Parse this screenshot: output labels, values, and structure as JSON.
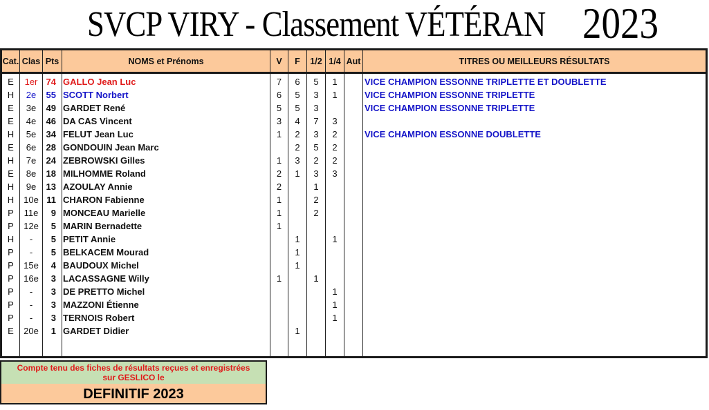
{
  "title": {
    "main": "SVCP VIRY - Classement VÉTÉRAN",
    "year": "2023"
  },
  "table": {
    "headers": [
      "Cat.",
      "Clas",
      "Pts",
      "NOMS et Prénoms",
      "V",
      "F",
      "1/2",
      "1/4",
      "Aut",
      "TITRES OU MEILLEURS RÉSULTATS"
    ],
    "rows": [
      {
        "cat": "E",
        "clas": "1er",
        "pts": "74",
        "name": "GALLO Jean Luc",
        "v": "7",
        "f": "6",
        "half": "5",
        "quarter": "1",
        "aut": "",
        "titre": "VICE CHAMPION ESSONNE TRIPLETTE ET DOUBLETTE",
        "color": "red"
      },
      {
        "cat": "H",
        "clas": "2e",
        "pts": "55",
        "name": "SCOTT Norbert",
        "v": "6",
        "f": "5",
        "half": "3",
        "quarter": "1",
        "aut": "",
        "titre": "VICE CHAMPION ESSONNE TRIPLETTE",
        "color": "blue"
      },
      {
        "cat": "E",
        "clas": "3e",
        "pts": "49",
        "name": "GARDET René",
        "v": "5",
        "f": "5",
        "half": "3",
        "quarter": "",
        "aut": "",
        "titre": "VICE CHAMPION ESSONNE TRIPLETTE",
        "color": ""
      },
      {
        "cat": "E",
        "clas": "4e",
        "pts": "46",
        "name": "DA CAS Vincent",
        "v": "3",
        "f": "4",
        "half": "7",
        "quarter": "3",
        "aut": "",
        "titre": "",
        "color": ""
      },
      {
        "cat": "H",
        "clas": "5e",
        "pts": "34",
        "name": "FELUT Jean Luc",
        "v": "1",
        "f": "2",
        "half": "3",
        "quarter": "2",
        "aut": "",
        "titre": "VICE CHAMPION ESSONNE DOUBLETTE",
        "color": ""
      },
      {
        "cat": "E",
        "clas": "6e",
        "pts": "28",
        "name": "GONDOUIN Jean Marc",
        "v": "",
        "f": "2",
        "half": "5",
        "quarter": "2",
        "aut": "",
        "titre": "",
        "color": ""
      },
      {
        "cat": "H",
        "clas": "7e",
        "pts": "24",
        "name": "ZEBROWSKI Gilles",
        "v": "1",
        "f": "3",
        "half": "2",
        "quarter": "2",
        "aut": "",
        "titre": "",
        "color": ""
      },
      {
        "cat": "E",
        "clas": "8e",
        "pts": "18",
        "name": "MILHOMME Roland",
        "v": "2",
        "f": "1",
        "half": "3",
        "quarter": "3",
        "aut": "",
        "titre": "",
        "color": ""
      },
      {
        "cat": "H",
        "clas": "9e",
        "pts": "13",
        "name": "AZOULAY Annie",
        "v": "2",
        "f": "",
        "half": "1",
        "quarter": "",
        "aut": "",
        "titre": "",
        "color": ""
      },
      {
        "cat": "H",
        "clas": "10e",
        "pts": "11",
        "name": "CHARON Fabienne",
        "v": "1",
        "f": "",
        "half": "2",
        "quarter": "",
        "aut": "",
        "titre": "",
        "color": ""
      },
      {
        "cat": "P",
        "clas": "11e",
        "pts": "9",
        "name": "MONCEAU Marielle",
        "v": "1",
        "f": "",
        "half": "2",
        "quarter": "",
        "aut": "",
        "titre": "",
        "color": ""
      },
      {
        "cat": "P",
        "clas": "12e",
        "pts": "5",
        "name": "MARIN Bernadette",
        "v": "1",
        "f": "",
        "half": "",
        "quarter": "",
        "aut": "",
        "titre": "",
        "color": ""
      },
      {
        "cat": "H",
        "clas": "-",
        "pts": "5",
        "name": "PETIT Annie",
        "v": "",
        "f": "1",
        "half": "",
        "quarter": "1",
        "aut": "",
        "titre": "",
        "color": ""
      },
      {
        "cat": "P",
        "clas": "-",
        "pts": "5",
        "name": "BELKACEM Mourad",
        "v": "",
        "f": "1",
        "half": "",
        "quarter": "",
        "aut": "",
        "titre": "",
        "color": ""
      },
      {
        "cat": "P",
        "clas": "15e",
        "pts": "4",
        "name": "BAUDOUX Michel",
        "v": "",
        "f": "1",
        "half": "",
        "quarter": "",
        "aut": "",
        "titre": "",
        "color": ""
      },
      {
        "cat": "P",
        "clas": "16e",
        "pts": "3",
        "name": "LACASSAGNE Willy",
        "v": "1",
        "f": "",
        "half": "1",
        "quarter": "",
        "aut": "",
        "titre": "",
        "color": ""
      },
      {
        "cat": "P",
        "clas": "-",
        "pts": "3",
        "name": "DE PRETTO Michel",
        "v": "",
        "f": "",
        "half": "",
        "quarter": "1",
        "aut": "",
        "titre": "",
        "color": ""
      },
      {
        "cat": "P",
        "clas": "-",
        "pts": "3",
        "name": "MAZZONI Étienne",
        "v": "",
        "f": "",
        "half": "",
        "quarter": "1",
        "aut": "",
        "titre": "",
        "color": ""
      },
      {
        "cat": "P",
        "clas": "-",
        "pts": "3",
        "name": "TERNOIS Robert",
        "v": "",
        "f": "",
        "half": "",
        "quarter": "1",
        "aut": "",
        "titre": "",
        "color": ""
      },
      {
        "cat": "E",
        "clas": "20e",
        "pts": "1",
        "name": "GARDET Didier",
        "v": "",
        "f": "1",
        "half": "",
        "quarter": "",
        "aut": "",
        "titre": "",
        "color": ""
      }
    ]
  },
  "footer": {
    "note_line1": "Compte tenu des fiches de résultats reçues et enregistrées",
    "note_line2": "sur GESLICO le",
    "status": "DEFINITIF 2023"
  },
  "colors": {
    "header_bg": "#fcc99b",
    "note_bg": "#c6e0b4",
    "red": "#e01b1b",
    "blue": "#1515c8"
  }
}
